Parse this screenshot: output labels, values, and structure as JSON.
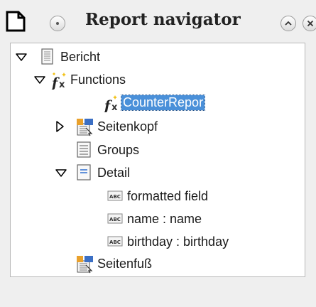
{
  "window": {
    "title": "Report navigator",
    "title_icon": "document-icon",
    "menu_icon": "dot-circle-icon",
    "minimize_icon": "chevron-up-icon",
    "close_icon": "close-icon"
  },
  "tree": {
    "selected_color": "#4a90d9",
    "items": [
      {
        "label": "Bericht",
        "icon": "report-icon",
        "state": "expanded"
      },
      {
        "label": "Functions",
        "icon": "functions-icon",
        "state": "expanded"
      },
      {
        "label": "CounterRepor",
        "icon": "function-icon",
        "selected": true
      },
      {
        "label": "Seitenkopf",
        "icon": "section-icon",
        "state": "collapsed"
      },
      {
        "label": "Groups",
        "icon": "groups-icon"
      },
      {
        "label": "Detail",
        "icon": "detail-icon",
        "state": "expanded"
      },
      {
        "label": "formatted field",
        "icon": "text-field-icon"
      },
      {
        "label": "name : name",
        "icon": "text-field-icon"
      },
      {
        "label": "birthday : birthday",
        "icon": "text-field-icon"
      },
      {
        "label": "Seitenfuß",
        "icon": "section-icon"
      }
    ]
  }
}
